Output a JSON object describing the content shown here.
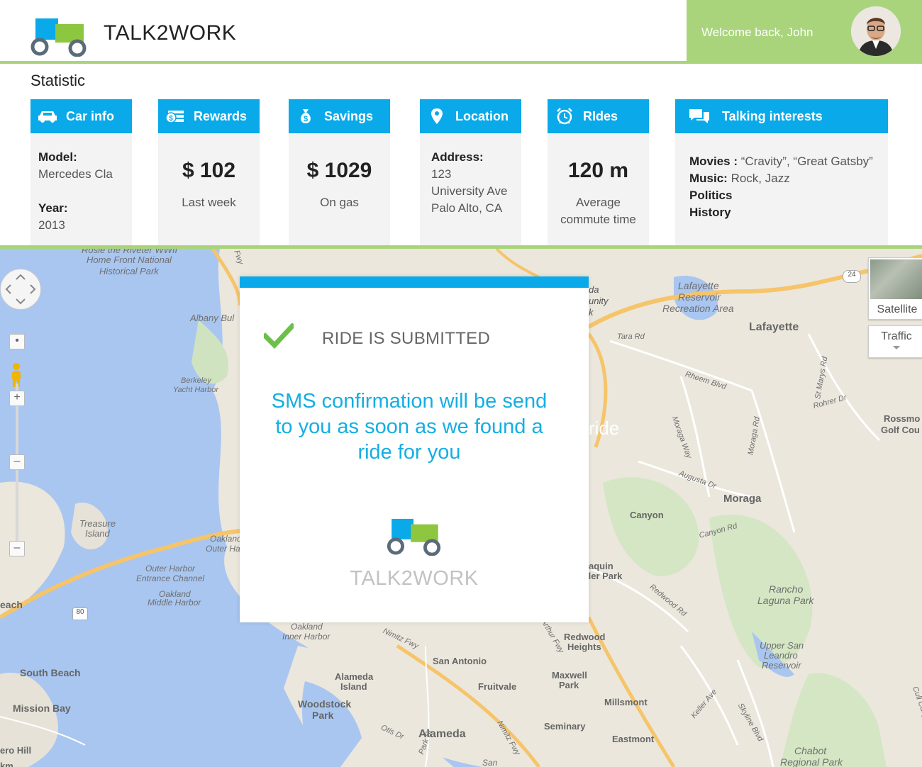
{
  "header": {
    "brand": "TALK2WORK",
    "welcome": "Welcome back, John",
    "colors": {
      "accent_green": "#a9d47c",
      "accent_blue": "#0aa9e9"
    }
  },
  "statistic": {
    "title": "Statistic",
    "cards": {
      "car": {
        "title": "Car info",
        "icon": "car-icon",
        "model_label": "Model:",
        "model_value": "Mercedes Cla",
        "year_label": "Year:",
        "year_value": "2013"
      },
      "rewards": {
        "title": "Rewards",
        "icon": "money-icon",
        "value": "$ 102",
        "caption": "Last week"
      },
      "savings": {
        "title": "Savings",
        "icon": "money-bag-icon",
        "value": "$ 1029",
        "caption": "On gas"
      },
      "location": {
        "title": "Location",
        "icon": "map-pin-icon",
        "address_label": "Address:",
        "line1": "123",
        "line2": "University Ave",
        "line3": "Palo Alto, CA"
      },
      "rides": {
        "title": "RIdes",
        "icon": "alarm-clock-icon",
        "value": "120 m",
        "caption1": "Average",
        "caption2": "commute time"
      },
      "interests": {
        "title": "Talking interests",
        "icon": "chat-icon",
        "movies_label": "Movies :",
        "movies_value": " “Cravity”, “Great Gatsby”",
        "music_label": "Music:",
        "music_value": " Rock, Jazz",
        "item3": "Politics",
        "item4": "History"
      }
    }
  },
  "map": {
    "satellite": "Satellite",
    "traffic": "Traffic",
    "labels": {
      "rosie": "Rosie the Riveter WWII",
      "home_front": "Home Front National",
      "historical_park": "Historical Park",
      "albany": "Albany Bul",
      "berkeley": "Berkeley",
      "yacht": "Yacht Harbor",
      "treasure": "Treasure",
      "island": "Island",
      "oakland_outer": "Oakland",
      "outer_ha": "Outer Ha",
      "outer_harbor": "Outer Harbor",
      "entrance": "Entrance Channel",
      "oakland_middle": "Oakland",
      "middle_harbor": "Middle Harbor",
      "each": "each",
      "south_beach": "South Beach",
      "mission_bay": "Mission Bay",
      "oakland_inner": "Oakland",
      "inner_harbor": "Inner Harbor",
      "alameda_island": "Alameda",
      "island2": "Island",
      "woodstock": "Woodstock",
      "park": "Park",
      "alameda": "Alameda",
      "san_antonio": "San Antonio",
      "fruitvale": "Fruitvale",
      "maxwell": "Maxwell",
      "maxwell_park": "Park",
      "redwood": "Redwood",
      "heights": "Heights",
      "millsmont": "Millsmont",
      "seminary": "Seminary",
      "eastmont": "Eastmont",
      "lafayette_res": "Lafayette",
      "reservoir": "Reservoir",
      "rec_area": "Recreation Area",
      "lafayette": "Lafayette",
      "tara": "Tara Rd",
      "rheem": "Rheem Blvd",
      "st_marys": "St Marys Rd",
      "rohrer": "Rohrer Dr",
      "moraga_way": "Moraga Way",
      "moraga_rd": "Moraga Rd",
      "augusta": "Augusta Dr",
      "moraga": "Moraga",
      "canyon": "Canyon",
      "canyon_rd": "Canyon Rd",
      "rossmo": "Rossmo",
      "golf": "Golf Cou",
      "joaquin": "aquin",
      "ller_park": "ller Park",
      "redwood_rd": "Redwood Rd",
      "rancho": "Rancho",
      "laguna": "Laguna Park",
      "upper_san": "Upper San",
      "leandro": "Leandro",
      "reservoir2": "Reservoir",
      "keller": "Keller Ave",
      "skyline": "Skyline Blvd",
      "chabot": "Chabot",
      "regional": "Regional Park",
      "nimitz": "Nimitz Fwy",
      "nimitz2": "Nimitz Fwy",
      "arthur": "Arthur Fwy",
      "otis": "Otis Dr",
      "park_st": "Park St",
      "san": "San",
      "ero_hill": "ero Hill",
      "km": "km",
      "da": "da",
      "unity": "unity",
      "k": "k",
      "ride": "ride",
      "cull": "Cull Canyon",
      "hwy24": "24",
      "hwy80": "80",
      "fwy": "Fwy"
    }
  },
  "modal": {
    "title": "RIDE IS SUBMITTED",
    "line1": "SMS confirmation will be send",
    "line2": "to you as soon as we found a",
    "line3": "ride for you",
    "brand": "TALK2WORK"
  }
}
